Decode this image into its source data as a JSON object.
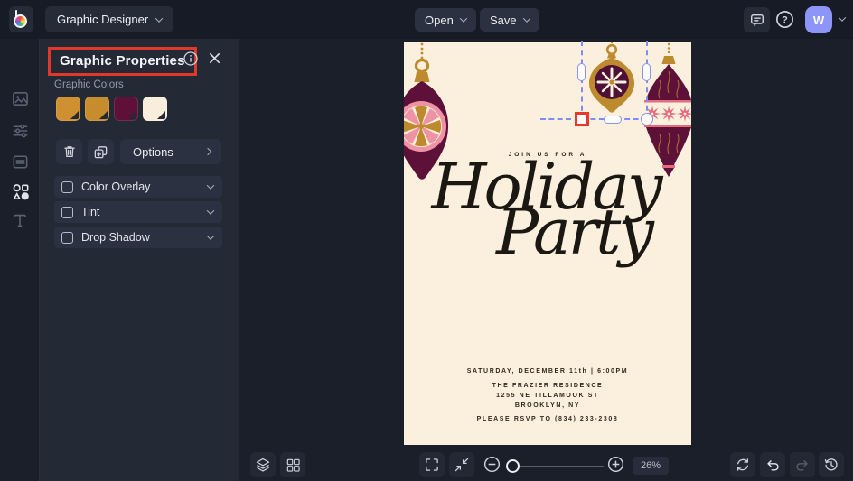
{
  "topbar": {
    "mode_label": "Graphic Designer",
    "open_label": "Open",
    "save_label": "Save",
    "help_glyph": "?",
    "avatar_initial": "W"
  },
  "panel": {
    "title": "Graphic Properties",
    "colors_label": "Graphic Colors",
    "swatches": [
      "#ce9030",
      "#c78c2c",
      "#5e1038",
      "#f9eedc"
    ],
    "options_label": "Options",
    "toggles": [
      {
        "label": "Color Overlay"
      },
      {
        "label": "Tint"
      },
      {
        "label": "Drop Shadow"
      }
    ]
  },
  "card": {
    "eyebrow": "JOIN US FOR A",
    "title_line1": "Holiday",
    "title_line2": "Party",
    "datetime": "SATURDAY, DECEMBER 11th | 6:00PM",
    "venue": "THE FRAZIER RESIDENCE",
    "address": "1255 NE TILLAMOOK ST",
    "city": "BROOKLYN, NY",
    "rsvp": "PLEASE RSVP TO (834) 233-2308"
  },
  "bottombar": {
    "zoom_value": "26%"
  },
  "colors": {
    "annotation_red": "#e0392b",
    "selection_blue": "#7f8cf5",
    "avatar_bg": "#8d95f7",
    "card_cream": "#faf0dd",
    "ornament_maroon": "#5d1139",
    "ornament_gold": "#bd8a2e",
    "ornament_pink": "#ef93a4"
  }
}
